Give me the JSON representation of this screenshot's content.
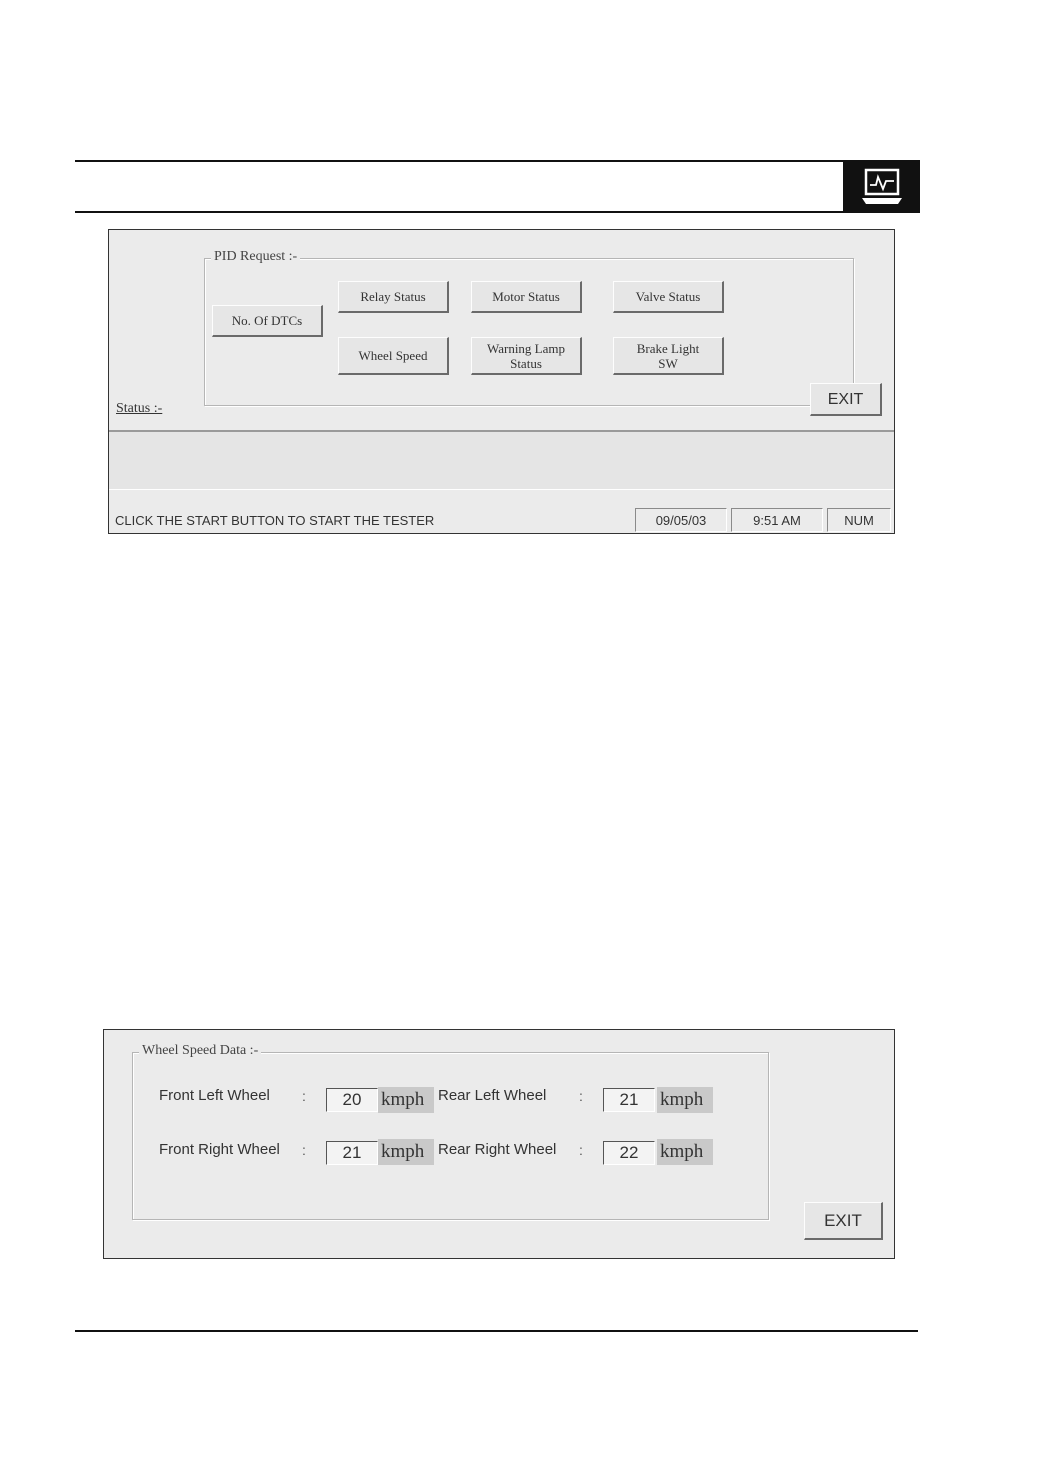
{
  "page": {
    "header_icon": "laptop-oscilloscope-icon"
  },
  "screen1": {
    "group_title": "PID Request :-",
    "buttons": {
      "no_of_dtcs": "No. Of DTCs",
      "relay_status": "Relay Status",
      "motor_status": "Motor Status",
      "valve_status": "Valve Status",
      "wheel_speed": "Wheel Speed",
      "warning_lamp_line1": "Warning Lamp",
      "warning_lamp_line2": "Status",
      "brake_light_line1": "Brake Light",
      "brake_light_line2": "SW"
    },
    "exit_label": "EXIT",
    "status_label": "Status :-",
    "statusbar": {
      "message": "CLICK THE START BUTTON TO START THE TESTER",
      "date": "09/05/03",
      "time": "9:51 AM",
      "num": "NUM"
    }
  },
  "screen2": {
    "group_title": "Wheel Speed Data :-",
    "unit": "kmph",
    "wheels": {
      "front_left": {
        "label": "Front Left Wheel",
        "value": "20"
      },
      "front_right": {
        "label": "Front Right Wheel",
        "value": "21"
      },
      "rear_left": {
        "label": "Rear Left Wheel",
        "value": "21"
      },
      "rear_right": {
        "label": "Rear Right Wheel",
        "value": "22"
      }
    },
    "exit_label": "EXIT"
  },
  "colors": {
    "panel_bg": "#ebebeb",
    "unit_bg": "#c9c9c9",
    "header_badge": "#111111"
  }
}
